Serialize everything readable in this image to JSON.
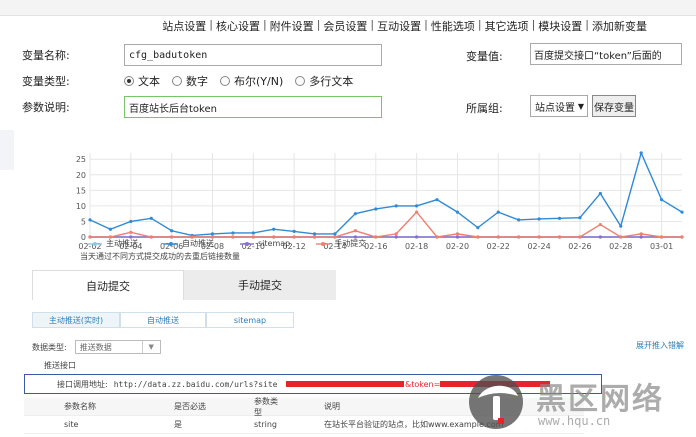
{
  "nav": {
    "items": [
      "站点设置",
      "核心设置",
      "附件设置",
      "会员设置",
      "互动设置",
      "性能选项",
      "其它选项",
      "模块设置",
      "添加新变量"
    ]
  },
  "form": {
    "var_name_label": "变量名称:",
    "var_name_value": "cfg_badutoken",
    "var_value_label": "变量值:",
    "var_value_value": "百度提交接口“token”后面的",
    "var_type_label": "变量类型:",
    "var_type_options": [
      "文本",
      "数字",
      "布尔(Y/N)",
      "多行文本"
    ],
    "var_type_selected": "文本",
    "desc_label": "参数说明:",
    "desc_value": "百度站长后台token",
    "group_label": "所属组:",
    "group_value": "站点设置",
    "save_label": "保存变量"
  },
  "chart_data": {
    "type": "line",
    "x": [
      "02-02",
      "02-03",
      "02-04",
      "02-05",
      "02-06",
      "02-07",
      "02-08",
      "02-09",
      "02-10",
      "02-11",
      "02-12",
      "02-13",
      "02-14",
      "02-15",
      "02-16",
      "02-17",
      "02-18",
      "02-19",
      "02-20",
      "02-21",
      "02-22",
      "02-23",
      "02-24",
      "02-25",
      "02-26",
      "02-27",
      "02-28",
      "02-29",
      "03-01",
      "03-02"
    ],
    "xticks": [
      "02-02",
      "02-04",
      "02-06",
      "02-08",
      "02-10",
      "02-12",
      "02-14",
      "02-16",
      "02-18",
      "02-20",
      "02-22",
      "02-24",
      "02-26",
      "02-28",
      "03-01"
    ],
    "yticks": [
      0,
      5,
      10,
      15,
      20,
      25
    ],
    "ylim": [
      0,
      27
    ],
    "grid": true,
    "series": [
      {
        "name": "主动推送",
        "color": "#8cc9e8",
        "values": [
          0,
          0,
          0,
          0,
          0,
          0,
          0,
          0,
          0,
          0,
          0,
          0,
          0,
          0,
          0,
          0,
          0,
          0,
          0,
          0,
          0,
          0,
          0,
          0,
          0,
          0,
          0,
          0,
          0,
          0
        ]
      },
      {
        "name": "自动推送",
        "color": "#2f8bd6",
        "values": [
          5.5,
          2.5,
          5,
          6,
          2,
          0.5,
          1,
          1.3,
          1.3,
          2.5,
          1.8,
          1,
          1,
          7.5,
          9,
          10,
          10,
          12,
          8,
          3,
          8,
          5.5,
          5.8,
          6,
          6.2,
          14,
          3.5,
          35,
          12,
          8
        ]
      },
      {
        "name": "sitemap",
        "color": "#8a6fcf",
        "values": [
          0,
          0,
          0,
          0,
          0,
          0,
          0,
          0,
          0,
          0,
          0,
          0,
          0,
          0,
          0,
          0,
          0,
          0,
          0,
          0,
          0,
          0,
          0,
          0,
          0,
          0,
          0,
          0,
          0,
          0
        ]
      },
      {
        "name": "手动提交",
        "color": "#ef7f6f",
        "values": [
          0,
          0,
          1.5,
          0,
          0,
          0,
          0,
          0,
          0,
          0,
          0,
          0,
          0,
          2,
          0,
          1,
          8,
          0,
          1,
          0,
          0,
          0,
          0,
          0,
          0,
          4,
          0,
          1,
          0,
          0
        ]
      }
    ],
    "legend_position": "bottom",
    "note": "当天通过不同方式提交成功的去重后链接数量"
  },
  "tabs": [
    "自动提交",
    "手动提交"
  ],
  "subtabs": [
    "主动推送(实时)",
    "自动推送",
    "sitemap"
  ],
  "data_type_label": "数据类型:",
  "data_type_value": "推送数据",
  "help_link": "展开推入错解",
  "section_title": "推送接口",
  "url_label": "接口调用地址:",
  "url_value": "http://data.zz.baidu.com/urls?site",
  "url_token": "&token=",
  "table": {
    "headers": [
      "参数名称",
      "是否必选",
      "参数类型",
      "说明"
    ],
    "rows": [
      [
        "site",
        "是",
        "string",
        "在站长平台验证的站点，比如www.example.com"
      ]
    ]
  },
  "watermark": {
    "text": "黑区网络",
    "sub": "www.hqu.cn",
    "accent": "#e8232a"
  }
}
